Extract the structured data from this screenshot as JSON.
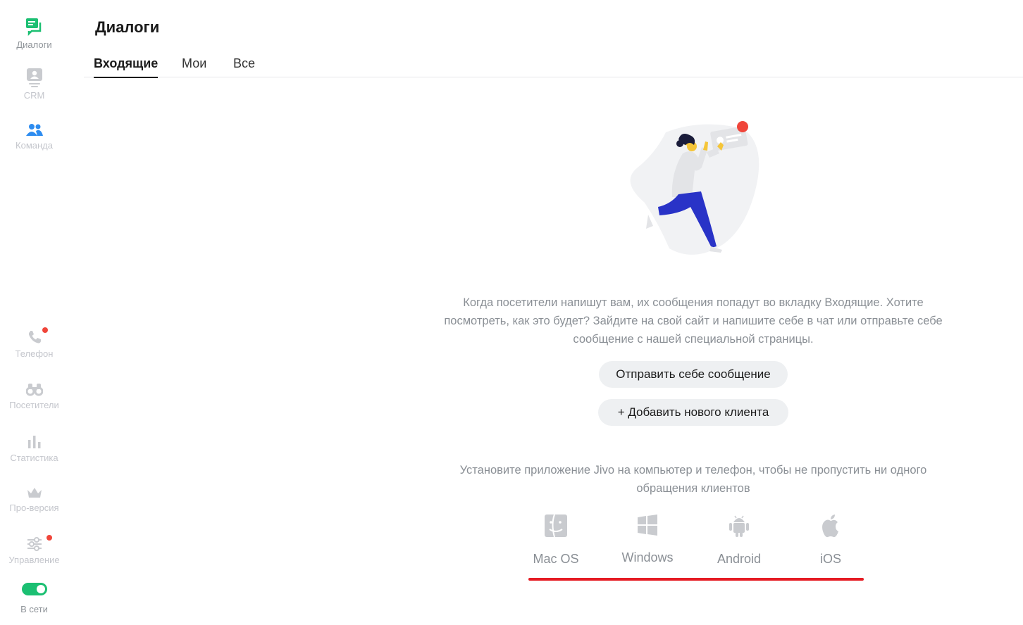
{
  "sidebar": {
    "items": [
      {
        "label": "Диалоги",
        "icon": "dialogs-icon"
      },
      {
        "label": "CRM",
        "icon": "crm-icon"
      },
      {
        "label": "Команда",
        "icon": "team-icon"
      },
      {
        "label": "Телефон",
        "icon": "phone-icon"
      },
      {
        "label": "Посетители",
        "icon": "binoculars-icon"
      },
      {
        "label": "Статистика",
        "icon": "bar-chart-icon"
      },
      {
        "label": "Про-версия",
        "icon": "crown-icon"
      },
      {
        "label": "Управление",
        "icon": "sliders-icon"
      }
    ],
    "online_label": "В сети"
  },
  "header": {
    "title": "Диалоги",
    "tabs": [
      {
        "label": "Входящие",
        "active": true
      },
      {
        "label": "Мои",
        "active": false
      },
      {
        "label": "Все",
        "active": false
      }
    ]
  },
  "empty_state": {
    "description": "Когда посетители напишут вам, их сообщения попадут во вкладку Входящие. Хотите посмотреть, как это будет? Зайдите на свой сайт и напишите себе в чат или отправьте себе сообщение с нашей специальной страницы.",
    "send_button": "Отправить себе сообщение",
    "add_client_button": "+ Добавить нового клиента",
    "install_text": "Установите приложение Jivo на компьютер и телефон, чтобы не пропустить ни одного обращения клиентов",
    "platforms": [
      {
        "label": "Mac OS",
        "icon": "finder-icon"
      },
      {
        "label": "Windows",
        "icon": "windows-icon"
      },
      {
        "label": "Android",
        "icon": "android-icon"
      },
      {
        "label": "iOS",
        "icon": "apple-icon"
      }
    ]
  },
  "colors": {
    "accent_green": "#1bbf72",
    "team_blue": "#2d8cf0",
    "notification_red": "#f0453a",
    "highlight_red": "#e51b23"
  }
}
